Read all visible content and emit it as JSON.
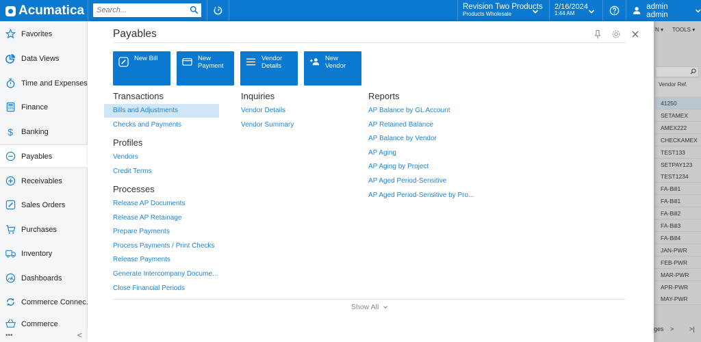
{
  "topbar": {
    "brand": "Acumatica",
    "search_placeholder": "Search...",
    "company": "Revision Two Products",
    "branch": "Products Wholesale",
    "date": "2/16/2024",
    "time": "1:44 AM",
    "user": "admin admin"
  },
  "sidebar": {
    "items": [
      {
        "label": "Favorites",
        "icon": "star-icon"
      },
      {
        "label": "Data Views",
        "icon": "pie-chart-icon"
      },
      {
        "label": "Time and Expenses",
        "icon": "stopwatch-icon"
      },
      {
        "label": "Finance",
        "icon": "calculator-icon"
      },
      {
        "label": "Banking",
        "icon": "dollar-icon"
      },
      {
        "label": "Payables",
        "icon": "minus-circle-icon",
        "active": true
      },
      {
        "label": "Receivables",
        "icon": "plus-circle-icon"
      },
      {
        "label": "Sales Orders",
        "icon": "pencil-square-icon"
      },
      {
        "label": "Purchases",
        "icon": "cart-icon"
      },
      {
        "label": "Inventory",
        "icon": "truck-icon"
      },
      {
        "label": "Dashboards",
        "icon": "gauge-icon"
      },
      {
        "label": "Commerce Connec...",
        "icon": "sync-icon"
      },
      {
        "label": "Commerce",
        "icon": "basket-icon"
      }
    ],
    "more": "•••",
    "collapse": "<"
  },
  "panel": {
    "title": "Payables",
    "tiles": [
      {
        "label": "New Bill",
        "icon": "edit-icon"
      },
      {
        "label": "New Payment",
        "icon": "credit-card-icon"
      },
      {
        "label": "Vendor Details",
        "icon": "list-icon"
      },
      {
        "label": "New Vendor",
        "icon": "add-user-icon"
      }
    ],
    "sections": {
      "transactions": {
        "title": "Transactions",
        "links": [
          "Bills and Adjustments",
          "Checks and Payments"
        ]
      },
      "profiles": {
        "title": "Profiles",
        "links": [
          "Vendors",
          "Credit Terms"
        ]
      },
      "processes": {
        "title": "Processes",
        "links": [
          "Release AP Documents",
          "Release AP Retainage",
          "Prepare Payments",
          "Process Payments / Print Checks",
          "Release Payments",
          "Generate Intercompany Docume...",
          "Close Financial Periods"
        ]
      },
      "inquiries": {
        "title": "Inquiries",
        "links": [
          "Vendor Details",
          "Vendor Summary"
        ]
      },
      "reports": {
        "title": "Reports",
        "links": [
          "AP Balance by GL Account",
          "AP Retained Balance",
          "AP Balance by Vendor",
          "AP Aging",
          "AP Aging by Project",
          "AP Aged Period-Sensitive",
          "AP Aged Period-Sensitive by Pro..."
        ]
      }
    },
    "show_all": "Show All"
  },
  "background": {
    "menu_partial": "N ▾",
    "tools": "TOOLS ▾",
    "column_header": "Vendor Ref.",
    "rows": [
      "41250",
      "SETAMEX",
      "AMEX222",
      "CHECKAMEX",
      "TEST133",
      "SETPAY123",
      "TEST1234",
      "FA-Bill1",
      "FA-Bill1",
      "FA-Bill2",
      "FA-Bill3",
      "FA-Bill4",
      "JAN-PWR",
      "FEB-PWR",
      "MAR-PWR",
      "APR-PWR",
      "MAY-PWR"
    ],
    "pager_partial": "ges",
    "pager_next": ">",
    "pager_last": ">|"
  }
}
